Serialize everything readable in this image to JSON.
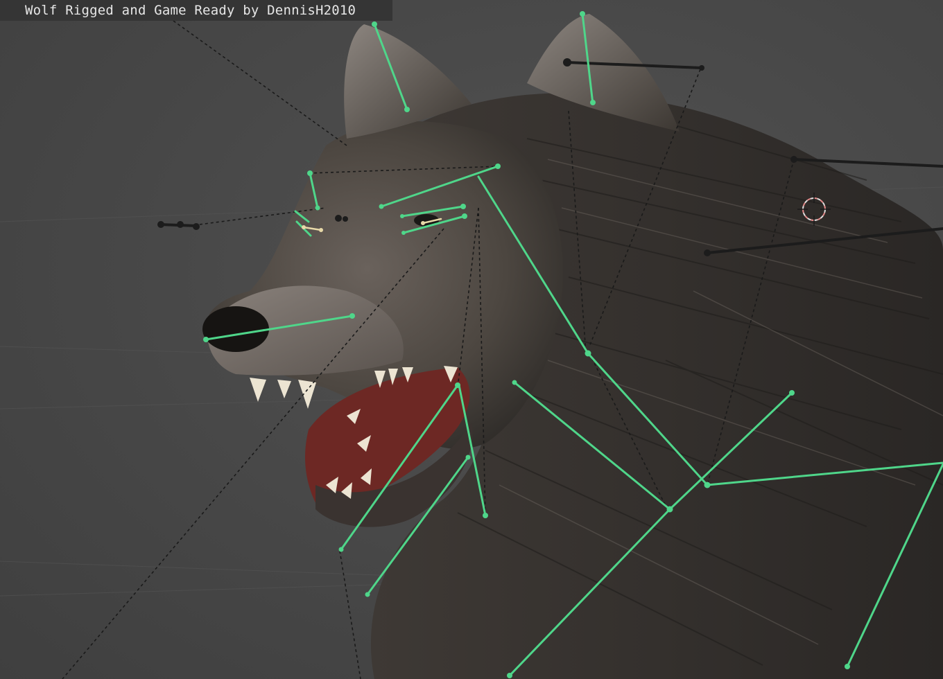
{
  "viewport": {
    "title": "Wolf Rigged and Game Ready by DennisH2010"
  },
  "colors": {
    "background": "#4a4a4a",
    "bone_selected": "#4fd68a",
    "bone_head_pose": "#e8d9a8",
    "bone_unselected": "#1c1c1c",
    "relationship_line": "#1a1a1a",
    "cursor_3d": "#e58a8a",
    "fur_dark": "#2e2b28",
    "fur_mid": "#5b5550",
    "fur_light": "#8c8480",
    "mouth": "#7a2e2a",
    "teeth": "#ece4d2"
  },
  "icons": {
    "cursor": "3d-cursor-icon"
  }
}
